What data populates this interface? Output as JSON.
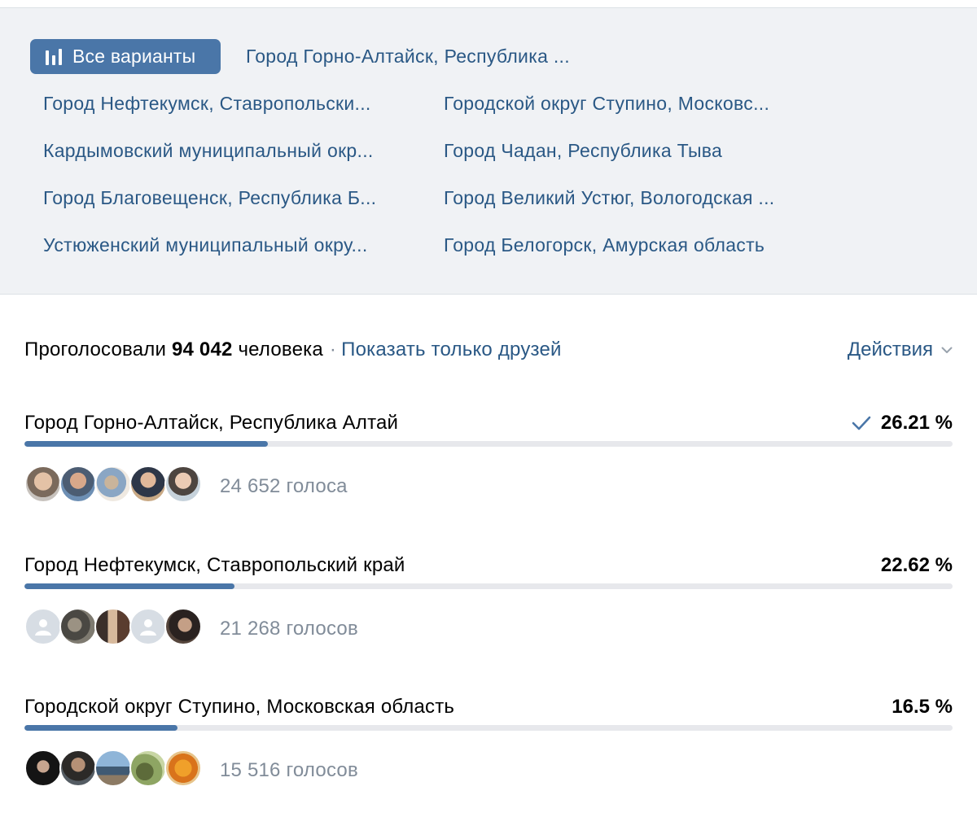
{
  "filters": {
    "all_label": "Все варианты",
    "variants": [
      "Город Горно-Алтайск, Республика ...",
      "Город Нефтекумск, Ставропольски...",
      "Городской округ Ступино, Московс...",
      "Кардымовский муниципальный окр...",
      "Город Чадан, Республика Тыва",
      "Город Благовещенск, Республика Б...",
      "Город Великий Устюг, Вологодская ...",
      "Устюженский муниципальный окру...",
      "Город Белогорск, Амурская область"
    ]
  },
  "summary": {
    "prefix": "Проголосовали",
    "count": "94 042",
    "suffix": "человека",
    "separator": "·",
    "friends_link": "Показать только друзей"
  },
  "actions_label": "Действия",
  "colors": {
    "accent": "#4a76a8",
    "link": "#2a5885",
    "muted": "#818c99",
    "panel": "#f0f2f5",
    "track": "#e7e8ec"
  },
  "options": [
    {
      "title": "Город Горно-Алтайск, Республика Алтай",
      "percent_label": "26.21 %",
      "percent": 26.21,
      "voted": true,
      "votes_label": "24 652 голоса",
      "avatars": [
        "photo",
        "photo",
        "photo",
        "photo",
        "photo"
      ]
    },
    {
      "title": "Город Нефтекумск, Ставропольский край",
      "percent_label": "22.62 %",
      "percent": 22.62,
      "voted": false,
      "votes_label": "21 268 голосов",
      "avatars": [
        "placeholder",
        "photo",
        "photo",
        "placeholder",
        "photo"
      ]
    },
    {
      "title": "Городской округ Ступино, Московская область",
      "percent_label": "16.5 %",
      "percent": 16.5,
      "voted": false,
      "votes_label": "15 516 голосов",
      "avatars": [
        "photo",
        "photo",
        "photo",
        "photo",
        "photo"
      ]
    }
  ]
}
